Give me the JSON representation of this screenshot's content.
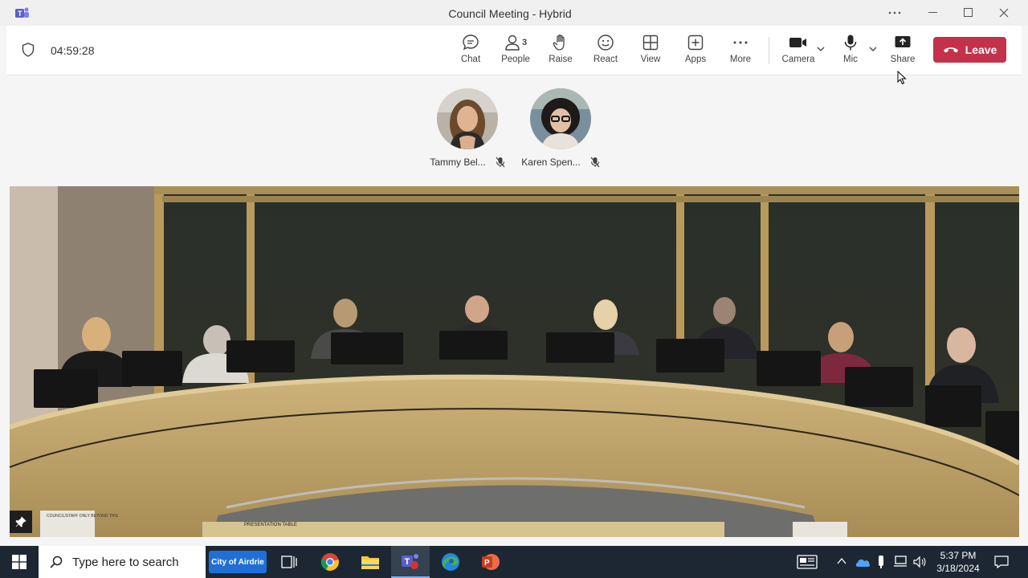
{
  "window": {
    "title": "Council Meeting - Hybrid"
  },
  "toolbar": {
    "timer": "04:59:28",
    "chat_label": "Chat",
    "people_label": "People",
    "people_count": "3",
    "raise_label": "Raise",
    "react_label": "React",
    "view_label": "View",
    "apps_label": "Apps",
    "more_label": "More",
    "camera_label": "Camera",
    "mic_label": "Mic",
    "share_label": "Share",
    "leave_label": "Leave",
    "leave_color": "#c4314b"
  },
  "participants": [
    {
      "name": "Tammy Bel...",
      "muted": true
    },
    {
      "name": "Karen Spen...",
      "muted": true
    }
  ],
  "video": {
    "placards": [
      "PRESENTATION TABLE",
      "COUNCIL/STAFF ONLY BEYOND THIS"
    ]
  },
  "taskbar": {
    "search_placeholder": "Type here to search",
    "pinned_site": "City of Airdrie",
    "time": "5:37 PM",
    "date": "3/18/2024",
    "apps": [
      "task-view",
      "chrome",
      "file-explorer",
      "teams",
      "edge",
      "powerpoint"
    ]
  }
}
